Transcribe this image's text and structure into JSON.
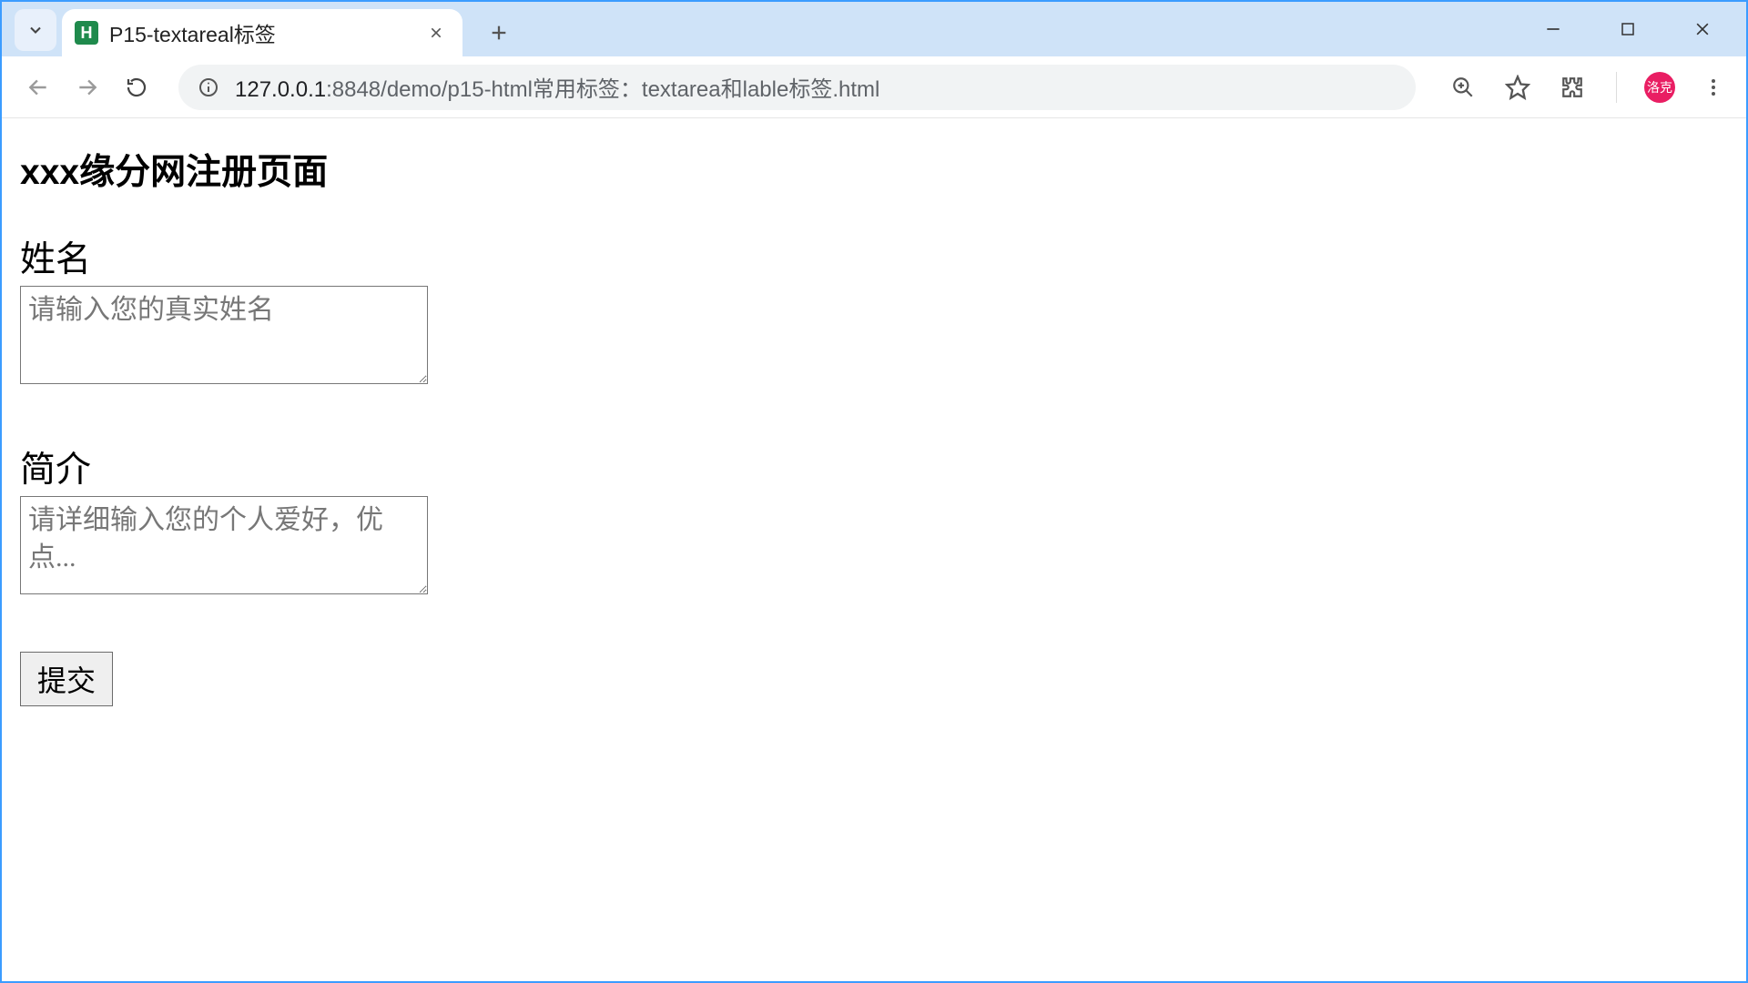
{
  "browser": {
    "tab_title": "P15-textareal标签",
    "favicon_letter": "H",
    "url_ip": "127.0.0.1",
    "url_rest": ":8848/demo/p15-html常用标签：textarea和lable标签.html",
    "avatar_text": "洛克"
  },
  "page": {
    "heading": "xxx缘分网注册页面",
    "name_label": "姓名",
    "name_placeholder": "请输入您的真实姓名",
    "bio_label": "简介",
    "bio_placeholder": "请详细输入您的个人爱好，优点...",
    "submit_label": "提交"
  }
}
